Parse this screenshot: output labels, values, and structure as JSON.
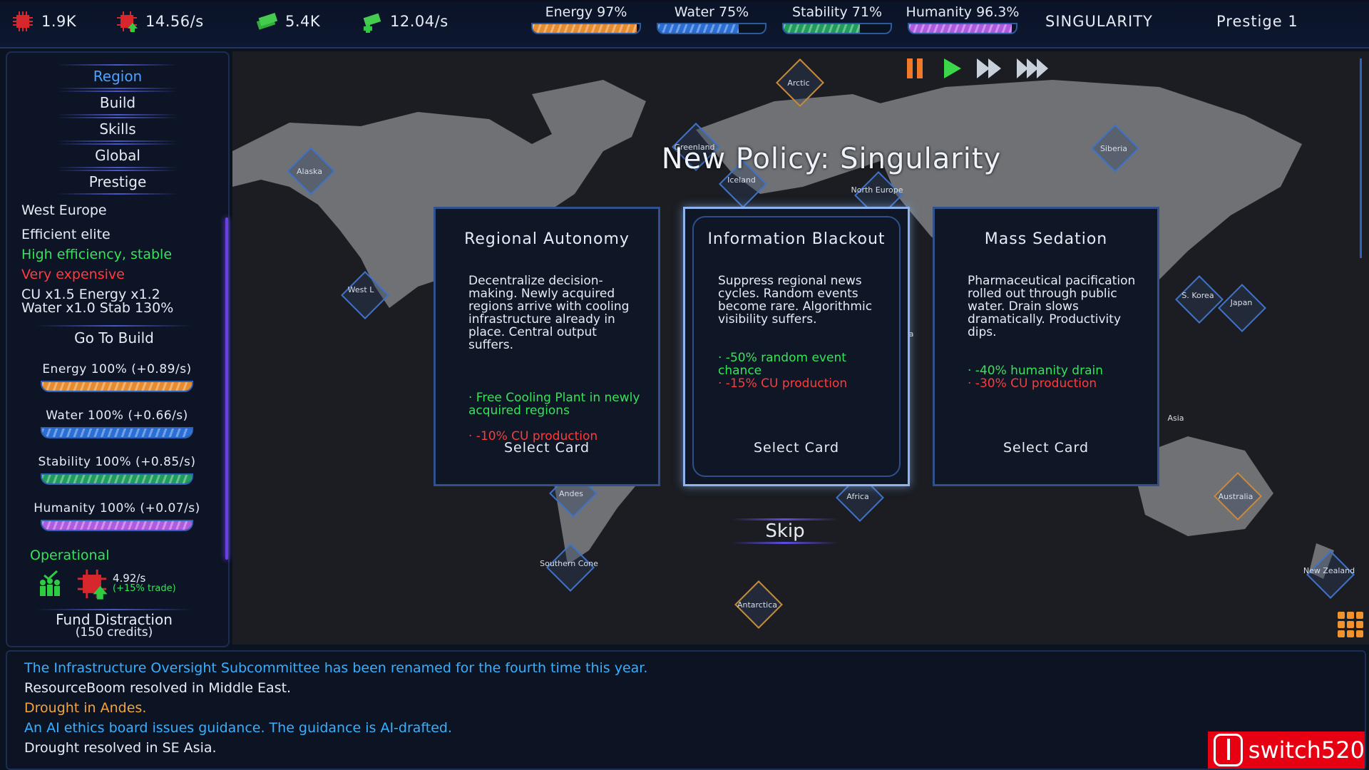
{
  "topbar": {
    "resources": [
      {
        "value": "1.9K",
        "icon": "chip-red-icon"
      },
      {
        "value": "14.56/s",
        "icon": "chip-red-up-icon"
      },
      {
        "value": "5.4K",
        "icon": "cash-green-icon"
      },
      {
        "value": "12.04/s",
        "icon": "cash-green-plus-icon"
      }
    ],
    "meters": [
      {
        "label": "Energy 97%",
        "value": 0.97,
        "color": "#e78b2f"
      },
      {
        "label": "Water 75%",
        "value": 0.75,
        "color": "#2a6fd6"
      },
      {
        "label": "Stability 71%",
        "value": 0.71,
        "color": "#1e9e5a"
      },
      {
        "label": "Humanity 96.3%",
        "value": 0.963,
        "color": "#b05ae0"
      }
    ],
    "policy_word": "SINGULARITY",
    "prestige": "Prestige 1"
  },
  "sidebar": {
    "nav": [
      "Region",
      "Build",
      "Skills",
      "Global",
      "Prestige"
    ],
    "region_name": "West Europe",
    "trait": "Efficient elite",
    "pro": "High efficiency, stable",
    "con": "Very expensive",
    "mult1": "CU x1.5  Energy x1.2",
    "mult2": "Water x1.0  Stab 130%",
    "go_to_build": "Go To Build",
    "stats": [
      {
        "label": "Energy  100%  (+0.89/s)",
        "value": 1.0,
        "color": "#e78b2f"
      },
      {
        "label": "Water  100%  (+0.66/s)",
        "value": 1.0,
        "color": "#2a6fd6"
      },
      {
        "label": "Stability  100%  (+0.85/s)",
        "value": 1.0,
        "color": "#1e9e5a"
      },
      {
        "label": "Humanity  100%  (+0.07/s)",
        "value": 1.0,
        "color": "#b05ae0"
      }
    ],
    "status": "Operational",
    "rate": "4.92/s",
    "trade": "(+15% trade)",
    "fund_line1": "Fund Distraction",
    "fund_line2": "(150 credits)"
  },
  "map": {
    "controls": [
      "pause",
      "play",
      "fast",
      "faster"
    ],
    "policy_title": "New Policy: Singularity",
    "regions": [
      {
        "name": "Arctic",
        "color": "orange"
      },
      {
        "name": "Greenland",
        "color": "blue"
      },
      {
        "name": "Alaska",
        "color": "blue"
      },
      {
        "name": "Iceland",
        "color": "blue"
      },
      {
        "name": "North Europe",
        "color": "blue"
      },
      {
        "name": "Siberia",
        "color": "blue"
      },
      {
        "name": "West L",
        "color": "blue"
      },
      {
        "name": "S. Korea",
        "color": "blue"
      },
      {
        "name": "Japan",
        "color": "blue"
      },
      {
        "name": "Mid Ea",
        "color": "orange"
      },
      {
        "name": "Asia",
        "color": "blue"
      },
      {
        "name": "Andes",
        "color": "blue"
      },
      {
        "name": "Africa",
        "color": "blue"
      },
      {
        "name": "Australia",
        "color": "orange"
      },
      {
        "name": "Southern Cone",
        "color": "blue"
      },
      {
        "name": "Antarctica",
        "color": "orange"
      },
      {
        "name": "New Zealand",
        "color": "blue"
      }
    ],
    "cards": [
      {
        "title": "Regional Autonomy",
        "desc": "Decentralize decision-making. Newly acquired regions arrive with cooling infrastructure already in place. Central output suffers.",
        "effects": [
          {
            "text": "· Free Cooling Plant in newly acquired regions",
            "tone": "good"
          },
          {
            "text": "· -10% CU production",
            "tone": "bad"
          }
        ],
        "select": "Select Card"
      },
      {
        "title": "Information Blackout",
        "desc": "Suppress regional news cycles. Random events become rare. Algorithmic visibility suffers.",
        "effects": [
          {
            "text": "· -50% random event chance",
            "tone": "good"
          },
          {
            "text": "· -15% CU production",
            "tone": "bad"
          }
        ],
        "select": "Select Card"
      },
      {
        "title": "Mass Sedation",
        "desc": "Pharmaceutical pacification rolled out through public water. Drain slows dramatically. Productivity dips.",
        "effects": [
          {
            "text": "· -40% humanity drain",
            "tone": "good"
          },
          {
            "text": "· -30% CU production",
            "tone": "bad"
          }
        ],
        "select": "Select Card"
      }
    ],
    "skip": "Skip"
  },
  "log": [
    {
      "text": "The Infrastructure Oversight Subcommittee has been renamed for the fourth time this year.",
      "tone": "blue"
    },
    {
      "text": "ResourceBoom resolved in Middle East.",
      "tone": "white"
    },
    {
      "text": "Drought in Andes.",
      "tone": "orange"
    },
    {
      "text": "An AI ethics board issues guidance. The guidance is AI-drafted.",
      "tone": "blue"
    },
    {
      "text": "Drought resolved in SE Asia.",
      "tone": "white"
    }
  ],
  "watermark": "switch520"
}
